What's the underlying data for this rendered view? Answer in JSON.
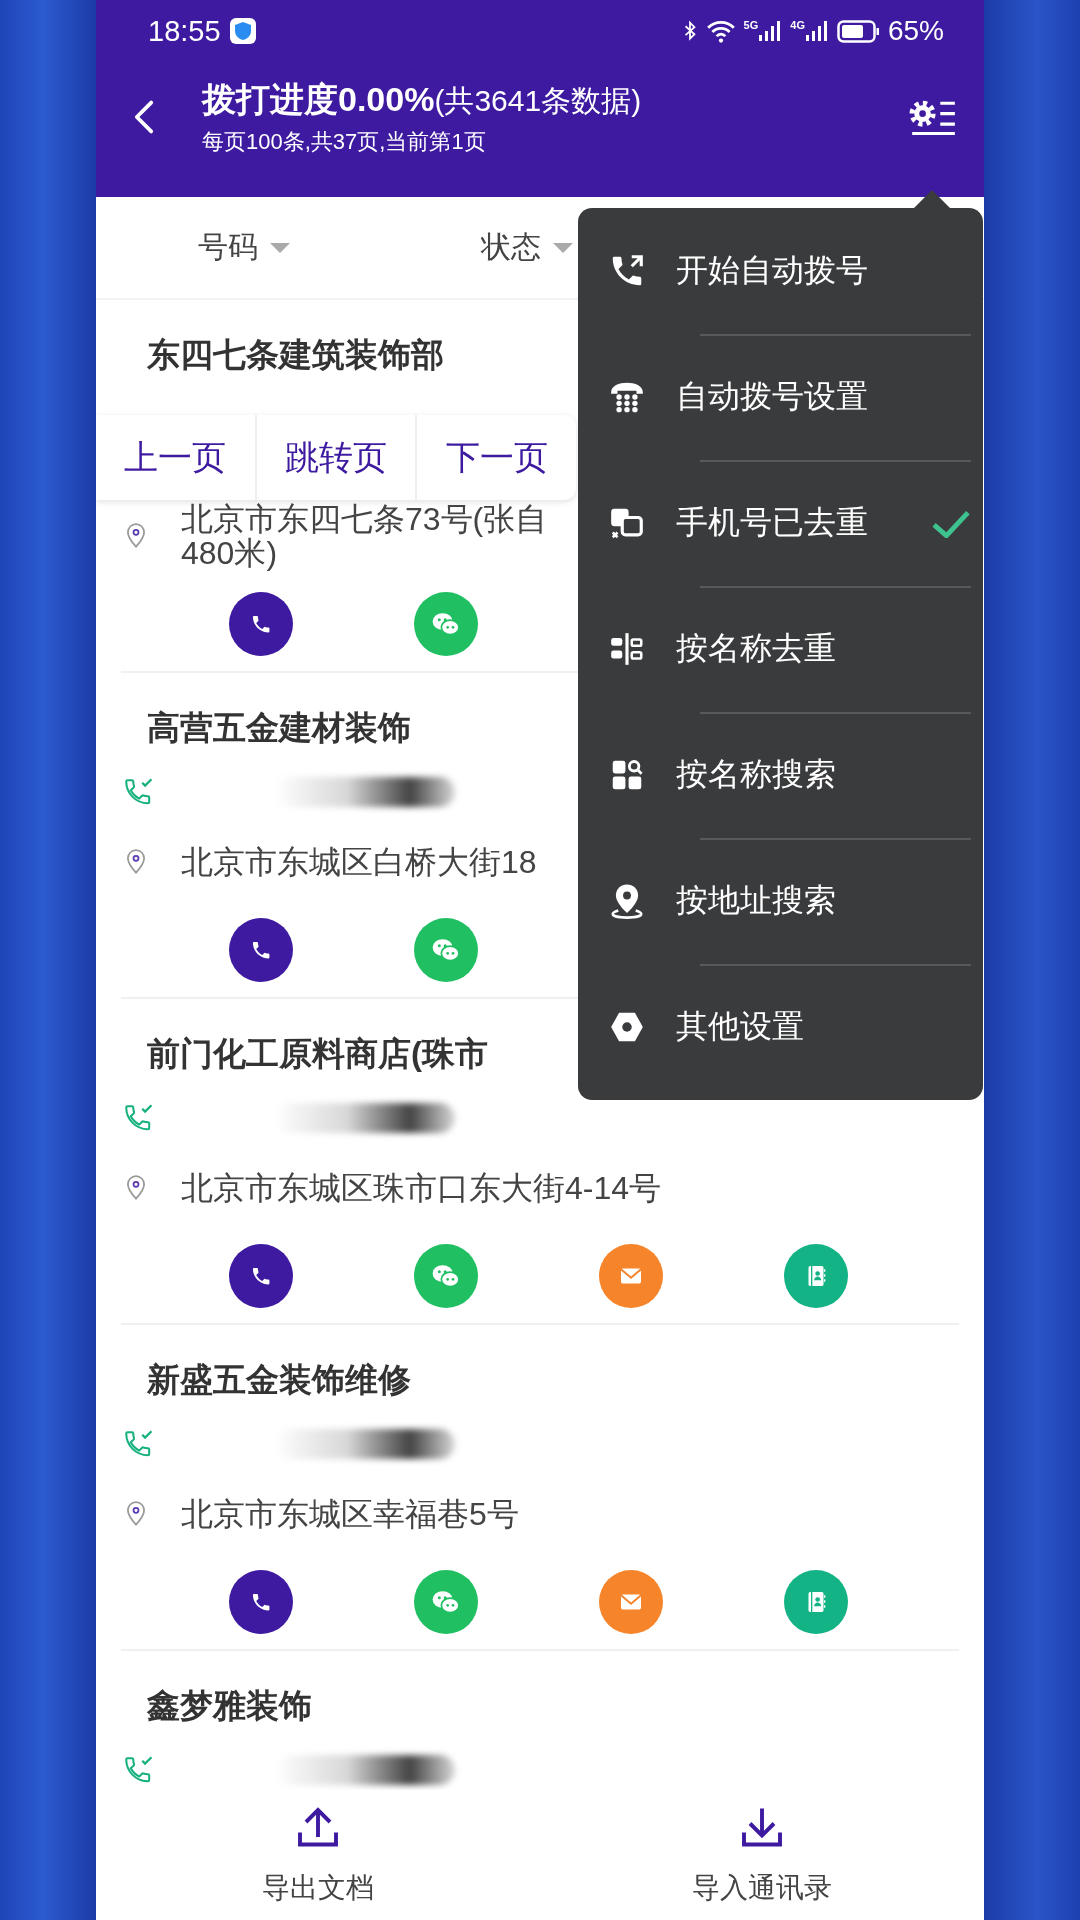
{
  "status_bar": {
    "time": "18:55",
    "network_1": "5G",
    "network_2": "4G",
    "battery": "65%"
  },
  "header": {
    "title": "**拨打进度0.00%**(共3641条数据)",
    "subtitle": "每页100条,共37页,当前第1页"
  },
  "filters": [
    {
      "label": "号码"
    },
    {
      "label": "状态"
    }
  ],
  "pager": [
    "上一页",
    "跳转页",
    "下一页"
  ],
  "shops": [
    {
      "name": "东四七条建筑装饰部",
      "address": [
        "北京市东四七条73号(张自",
        "480米)"
      ],
      "actions": [
        {
          "kind": "call"
        },
        {
          "kind": "wechat"
        }
      ]
    },
    {
      "name": "高营五金建材装饰",
      "called": true,
      "address": [
        "北京市东城区白桥大街18"
      ],
      "actions": [
        {
          "kind": "call"
        },
        {
          "kind": "wechat"
        }
      ]
    },
    {
      "name": "前门化工原料商店(珠市",
      "called": true,
      "address": [
        "北京市东城区珠市口东大街4-14号"
      ],
      "actions": [
        {
          "kind": "call"
        },
        {
          "kind": "wechat"
        },
        {
          "kind": "mail"
        },
        {
          "kind": "contacts"
        }
      ]
    },
    {
      "name": "新盛五金装饰维修",
      "called": true,
      "address": [
        "北京市东城区幸福巷5号"
      ],
      "actions": [
        {
          "kind": "call"
        },
        {
          "kind": "wechat"
        },
        {
          "kind": "mail"
        },
        {
          "kind": "contacts"
        }
      ]
    },
    {
      "name": "鑫梦雅装饰",
      "called": true
    }
  ],
  "menu": [
    {
      "label": "开始自动拨号",
      "checked": false
    },
    {
      "label": "自动拨号设置",
      "checked": false
    },
    {
      "label": "手机号已去重",
      "checked": true
    },
    {
      "label": "按名称去重",
      "checked": false
    },
    {
      "label": "按名称搜索",
      "checked": false
    },
    {
      "label": "按地址搜索",
      "checked": false
    },
    {
      "label": "其他设置",
      "checked": false
    }
  ],
  "bottom_bar": [
    {
      "kind": "export",
      "label": "导出文档"
    },
    {
      "kind": "import",
      "label": "导入通讯录"
    }
  ]
}
